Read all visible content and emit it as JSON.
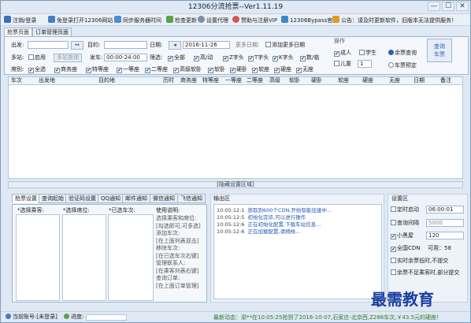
{
  "window": {
    "title": "12306分流抢票--Ver1.11.19",
    "minimize": "—",
    "maximize": "☐",
    "close": "✕"
  },
  "toolbar": [
    {
      "label": "注销/登录",
      "icon": "power-icon"
    },
    {
      "label": "免登录打开12306网站",
      "icon": "skip-icon"
    },
    {
      "label": "同步服务器时间",
      "icon": "sync-icon"
    },
    {
      "label": "检查更新",
      "icon": "download-icon"
    },
    {
      "label": "设置代理",
      "icon": "gear-icon"
    },
    {
      "label": "赞助与注册VIP",
      "icon": "heart-icon"
    },
    {
      "label": "12306Bypass官网",
      "icon": "home-icon"
    },
    {
      "label": "公告：请及时更新软件，旧版本无法提供服务！",
      "icon": "megaphone-icon"
    }
  ],
  "main_tabs": [
    "抢票页面",
    "订单管理页面"
  ],
  "form": {
    "from_label": "出发:",
    "to_label": "目的:",
    "swap": "↔",
    "date_label": "日期:",
    "date_value": "2016-11-26",
    "more_dates_label": "更多日期:",
    "add_dates": "添加更多日期",
    "multi_station_label": "多站:",
    "enable": "启用",
    "multi_station_btn": "多站查询",
    "depart_time_label": "发车:",
    "depart_time_value": "00:00-24:00",
    "filter_label": "筛选:",
    "filters": [
      "全部",
      "高/动",
      "Z字头",
      "T字头",
      "K字头",
      "数/临"
    ],
    "seats_label": "席别:",
    "seats": [
      "全选",
      "商务座",
      "特等座",
      "一等座",
      "二等座",
      "高级软卧",
      "软卧",
      "硬卧",
      "软座",
      "硬座",
      "无座"
    ],
    "ops_label": "操作",
    "adult": "成人",
    "student": "学生",
    "child": "儿童",
    "child_count": "1",
    "radio1": "余票查询",
    "radio2": "车票预定",
    "query_button": "查询\n车票"
  },
  "grid_headers": [
    "车次",
    "出发地",
    "目的地",
    "历时",
    "商务座",
    "特等座",
    "一等座",
    "二等座",
    "高级",
    "软卧",
    "硬卧",
    "软座",
    "硬座",
    "无座",
    "日期",
    "备注"
  ],
  "hide_bar": "[隐藏设置区域]",
  "lower_tabs": [
    "抢票设置",
    "查询起始",
    "验证码设置",
    "QQ通知",
    "邮件通知",
    "微信通知",
    "飞信通知"
  ],
  "lower_labels": {
    "passenger": "*选择乘客:",
    "seat": "*选择席位:",
    "train": "*已选车次:",
    "help_title": "使用说明:"
  },
  "help_lines": [
    "选择乘客和席位:",
    "[勾选即可,可多选]",
    "添加车次:",
    "[在上面列表双击]",
    "移除车次:",
    "[在已选车次右键]",
    "管理联系人:",
    "[在乘客列表右键]",
    "查询订单:",
    "[在上面订单管理]"
  ],
  "output": {
    "title": "输出区",
    "lines": [
      {
        "time": "10:05:12:1",
        "msg": "获取到600个CDN,开始智能加速中..."
      },
      {
        "time": "10:05:12:5",
        "msg": "初始化完毕,可以进行操作"
      },
      {
        "time": "10:05:12:6",
        "msg": "正在初始化配置,下载车站信息..."
      },
      {
        "time": "10:05:12:6",
        "msg": "正在加载配置,请稍候..."
      }
    ]
  },
  "settings": {
    "title": "设置区",
    "timer_label": "定时启动",
    "timer_value": "06:00:01",
    "interval_label": "查询间隔",
    "interval_value": "5000",
    "blackroom_label": "小黑屋",
    "blackroom_value": "120",
    "cdn_label": "全国CDN",
    "cdn_value": "可用：58",
    "partial_submit": "实时余票低时,不提交",
    "no_partial": "余票不足乘客时,部分提交"
  },
  "status": {
    "account": "当前账号:[未登录]",
    "progress": "进度:",
    "news": "最新动态：梁**在10:05:25抢到了2016-10-07,石家庄-北京西,Z286车次,￥43.5元的硬座！"
  },
  "watermark": "最需教育"
}
